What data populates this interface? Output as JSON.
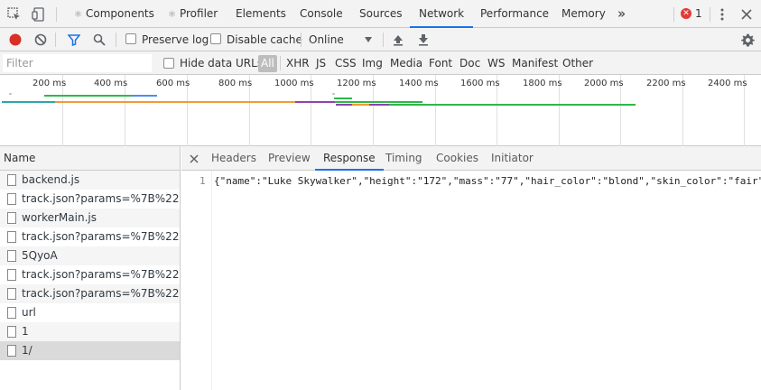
{
  "tabs": {
    "components": "Components",
    "profiler": "Profiler",
    "elements": "Elements",
    "console": "Console",
    "sources": "Sources",
    "network": "Network",
    "performance": "Performance",
    "memory": "Memory",
    "more": "»",
    "error_count": "1"
  },
  "toolbar": {
    "preserve_log": "Preserve log",
    "disable_cache": "Disable cache",
    "throttle": "Online"
  },
  "filter": {
    "placeholder": "Filter",
    "hide_data_urls": "Hide data URLs",
    "types": [
      "All",
      "XHR",
      "JS",
      "CSS",
      "Img",
      "Media",
      "Font",
      "Doc",
      "WS",
      "Manifest",
      "Other"
    ]
  },
  "overview": {
    "ticks": [
      "200 ms",
      "400 ms",
      "600 ms",
      "800 ms",
      "1000 ms",
      "1200 ms",
      "1400 ms",
      "1600 ms",
      "1800 ms",
      "2000 ms",
      "2200 ms",
      "2400 ms"
    ],
    "colors": {
      "green": "#2fb848",
      "blue": "#4c8df6",
      "orange": "#f29b38",
      "teal": "#2ea6a6",
      "purple": "#8e44ad"
    }
  },
  "requests": {
    "header": "Name",
    "items": [
      "backend.js",
      "track.json?params=%7B%22ev...",
      "workerMain.js",
      "track.json?params=%7B%22ev...",
      "5QyoA",
      "track.json?params=%7B%22ev...",
      "track.json?params=%7B%22ev...",
      "url",
      "1",
      "1/"
    ]
  },
  "detail": {
    "tabs": [
      "Headers",
      "Preview",
      "Response",
      "Timing",
      "Cookies",
      "Initiator"
    ],
    "line_number": "1",
    "response": "{\"name\":\"Luke Skywalker\",\"height\":\"172\",\"mass\":\"77\",\"hair_color\":\"blond\",\"skin_color\":\"fair\""
  }
}
